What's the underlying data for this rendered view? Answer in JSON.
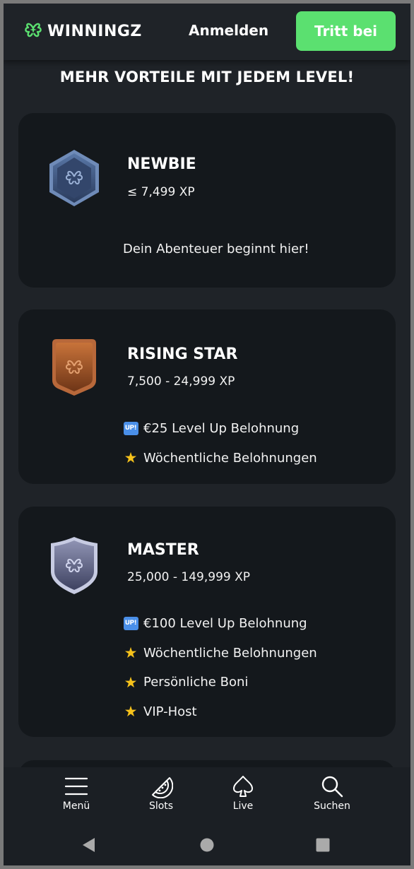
{
  "header": {
    "logo_text": "WINNINGZ",
    "login_label": "Anmelden",
    "join_label": "Tritt bei",
    "accent_color": "#5be070"
  },
  "page": {
    "heading": "MEHR VORTEILE MIT JEDEM LEVEL!"
  },
  "levels": [
    {
      "name": "NEWBIE",
      "xp": "≤ 7,499 XP",
      "badge_icon": "newbie-badge-icon",
      "description": "Dein Abenteuer beginnt hier!"
    },
    {
      "name": "RISING STAR",
      "xp": "7,500 - 24,999 XP",
      "badge_icon": "rising-star-badge-icon",
      "perks": [
        {
          "icon": "up-icon",
          "text": "€25 Level Up Belohnung"
        },
        {
          "icon": "star-icon",
          "text": "Wöchentliche Belohnungen"
        }
      ]
    },
    {
      "name": "MASTER",
      "xp": "25,000 - 149,999 XP",
      "badge_icon": "master-badge-icon",
      "perks": [
        {
          "icon": "up-icon",
          "text": "€100 Level Up Belohnung"
        },
        {
          "icon": "star-icon",
          "text": "Wöchentliche Belohnungen"
        },
        {
          "icon": "star-icon",
          "text": "Persönliche Boni"
        },
        {
          "icon": "star-icon",
          "text": "VIP-Host"
        }
      ]
    }
  ],
  "up_icon_text": "UP!",
  "star_icon_char": "★",
  "bottom_nav": {
    "items": [
      {
        "label": "Menü",
        "icon": "menu-icon"
      },
      {
        "label": "Slots",
        "icon": "watermelon-icon"
      },
      {
        "label": "Live",
        "icon": "spade-icon"
      },
      {
        "label": "Suchen",
        "icon": "search-icon"
      }
    ]
  },
  "system_nav": [
    "back-icon",
    "home-icon",
    "recents-icon"
  ]
}
